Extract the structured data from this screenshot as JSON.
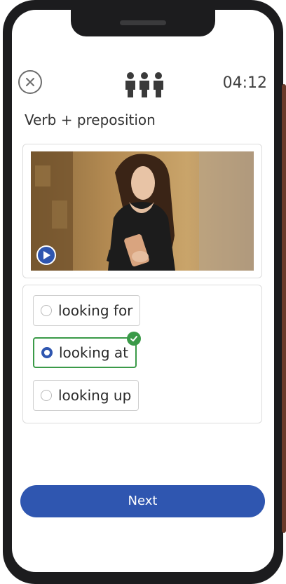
{
  "header": {
    "close_icon": "close-icon",
    "participants_icon": "three-people-icon",
    "timer": "04:12"
  },
  "exercise": {
    "title": "Verb + preposition",
    "video": {
      "play_icon": "play-icon",
      "thumbnail": "woman-looking-at-phone"
    },
    "options": [
      {
        "label": "looking for",
        "selected": false
      },
      {
        "label": "looking at",
        "selected": true,
        "correct": true
      },
      {
        "label": "looking up",
        "selected": false
      }
    ]
  },
  "footer": {
    "next_label": "Next"
  },
  "colors": {
    "accent": "#2f56b0",
    "correct": "#3a9a48",
    "text": "#333333"
  }
}
